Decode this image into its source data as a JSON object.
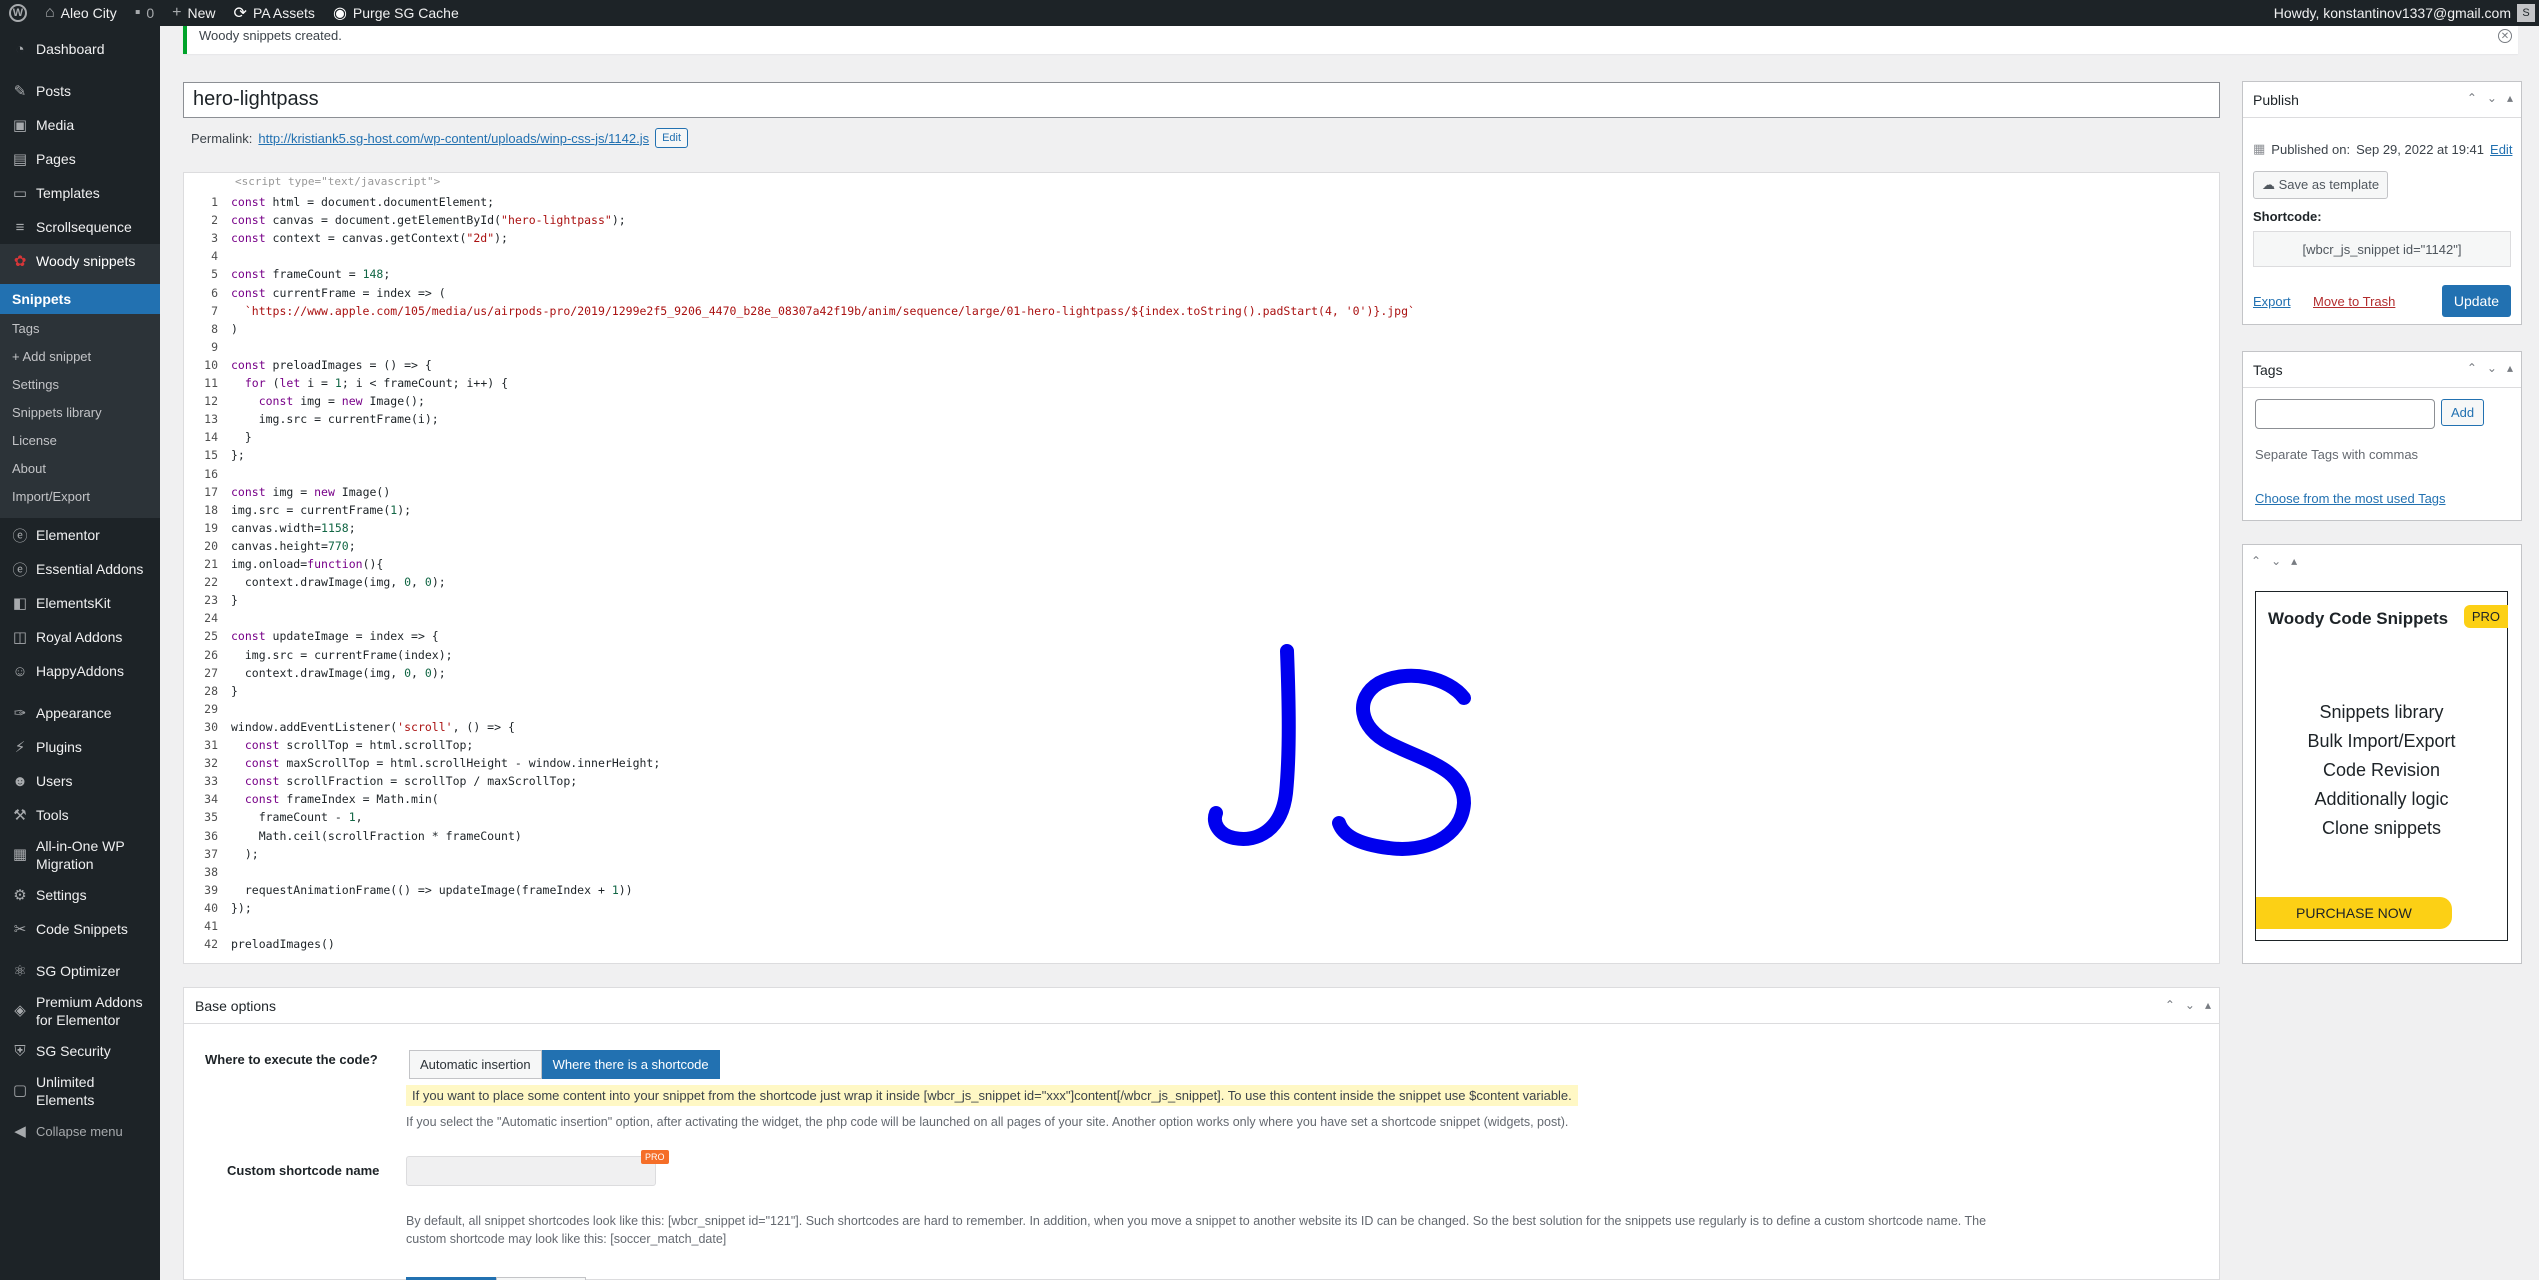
{
  "adminbar": {
    "site_name": "Aleo City",
    "comments_count": "0",
    "new_label": "New",
    "pa_assets_label": "PA Assets",
    "purge_label": "Purge SG Cache",
    "howdy": "Howdy, konstantinov1337@gmail.com"
  },
  "sidebar": {
    "dashboard": "Dashboard",
    "posts": "Posts",
    "media": "Media",
    "pages": "Pages",
    "templates": "Templates",
    "scrollsequence": "Scrollsequence",
    "woody": "Woody snippets",
    "sub": [
      "Snippets",
      "Tags",
      "+ Add snippet",
      "Settings",
      "Snippets library",
      "License",
      "About",
      "Import/Export"
    ],
    "elementor": "Elementor",
    "essential": "Essential Addons",
    "elementskit": "ElementsKit",
    "royal": "Royal Addons",
    "happy": "HappyAddons",
    "appearance": "Appearance",
    "plugins": "Plugins",
    "users": "Users",
    "tools": "Tools",
    "aio_line1": "All-in-One WP",
    "aio_line2": "Migration",
    "settings": "Settings",
    "code_snippets": "Code Snippets",
    "sg_optimizer": "SG Optimizer",
    "premium_line1": "Premium Addons",
    "premium_line2": "for Elementor",
    "sg_security": "SG Security",
    "unlimited_line1": "Unlimited",
    "unlimited_line2": "Elements",
    "collapse": "Collapse menu"
  },
  "notice": {
    "text": "Woody snippets created."
  },
  "title": {
    "value": "hero-lightpass"
  },
  "permalink": {
    "label": "Permalink:",
    "url_prefix": "http://kristiank5.sg-host.com/wp-content/uploads/winp-css-js/",
    "url_slug": "1142.js",
    "edit_label": "Edit"
  },
  "editor": {
    "placeholder": "<script type=\"text/javascript\">",
    "lines": [
      "const html = document.documentElement;",
      "const canvas = document.getElementById(\"hero-lightpass\");",
      "const context = canvas.getContext(\"2d\");",
      "",
      "const frameCount = 148;",
      "const currentFrame = index => (",
      "  `https://www.apple.com/105/media/us/airpods-pro/2019/1299e2f5_9206_4470_b28e_08307a42f19b/anim/sequence/large/01-hero-lightpass/${index.toString().padStart(4, '0')}.jpg`",
      ")",
      "",
      "const preloadImages = () => {",
      "  for (let i = 1; i < frameCount; i++) {",
      "    const img = new Image();",
      "    img.src = currentFrame(i);",
      "  }",
      "};",
      "",
      "const img = new Image()",
      "img.src = currentFrame(1);",
      "canvas.width=1158;",
      "canvas.height=770;",
      "img.onload=function(){",
      "  context.drawImage(img, 0, 0);",
      "}",
      "",
      "const updateImage = index => {",
      "  img.src = currentFrame(index);",
      "  context.drawImage(img, 0, 0);",
      "}",
      "",
      "window.addEventListener('scroll', () => {",
      "  const scrollTop = html.scrollTop;",
      "  const maxScrollTop = html.scrollHeight - window.innerHeight;",
      "  const scrollFraction = scrollTop / maxScrollTop;",
      "  const frameIndex = Math.min(",
      "    frameCount - 1,",
      "    Math.ceil(scrollFraction * frameCount)",
      "  );",
      "",
      "  requestAnimationFrame(() => updateImage(frameIndex + 1))",
      "});",
      "",
      "preloadImages()"
    ]
  },
  "base_options": {
    "title": "Base options",
    "where_label": "Where to execute the code?",
    "opt_auto": "Automatic insertion",
    "opt_shortcode": "Where there is a shortcode",
    "highlight": "If you want to place some content into your snippet from the shortcode just wrap it inside [wbcr_js_snippet id=\"xxx\"]content[/wbcr_js_snippet]. To use this content inside the snippet use $content variable.",
    "desc1": "If you select the \"Automatic insertion\" option, after activating the widget, the php code will be launched on all pages of your site. Another option works only where you have set a shortcode snippet (widgets, post).",
    "custom_label": "Custom shortcode name",
    "pro": "PRO",
    "desc2a": "By default, all snippet shortcodes look like this: [wbcr_snippet id=\"121\"]. Such shortcodes are hard to remember. In addition, when you move a snippet to another website its ID can be changed. So the best solution for the snippets use regularly is to define a custom shortcode name. The",
    "desc2b": "custom shortcode may look like this: [soccer_match_date]"
  },
  "publish": {
    "title": "Publish",
    "published_on": "Published on:",
    "published_date": "Sep 29, 2022 at 19:41",
    "edit": "Edit",
    "save_template": "Save as template",
    "shortcode_label": "Shortcode:",
    "shortcode_value": "[wbcr_js_snippet id=\"1142\"]",
    "export": "Export",
    "trash": "Move to Trash",
    "update": "Update"
  },
  "tags": {
    "title": "Tags",
    "add": "Add",
    "hint": "Separate Tags with commas",
    "choose": "Choose from the most used Tags"
  },
  "promo": {
    "title": "Woody Code Snippets",
    "pro": "PRO",
    "features": [
      "Snippets library",
      "Bulk Import/Export",
      "Code Revision",
      "Additionally logic",
      "Clone snippets"
    ],
    "purchase": "PURCHASE NOW"
  },
  "colors": {
    "admin_bg": "#1d2327",
    "accent": "#2271b1",
    "promo_yellow": "#fcd015",
    "drawing_blue": "#0000ee"
  }
}
